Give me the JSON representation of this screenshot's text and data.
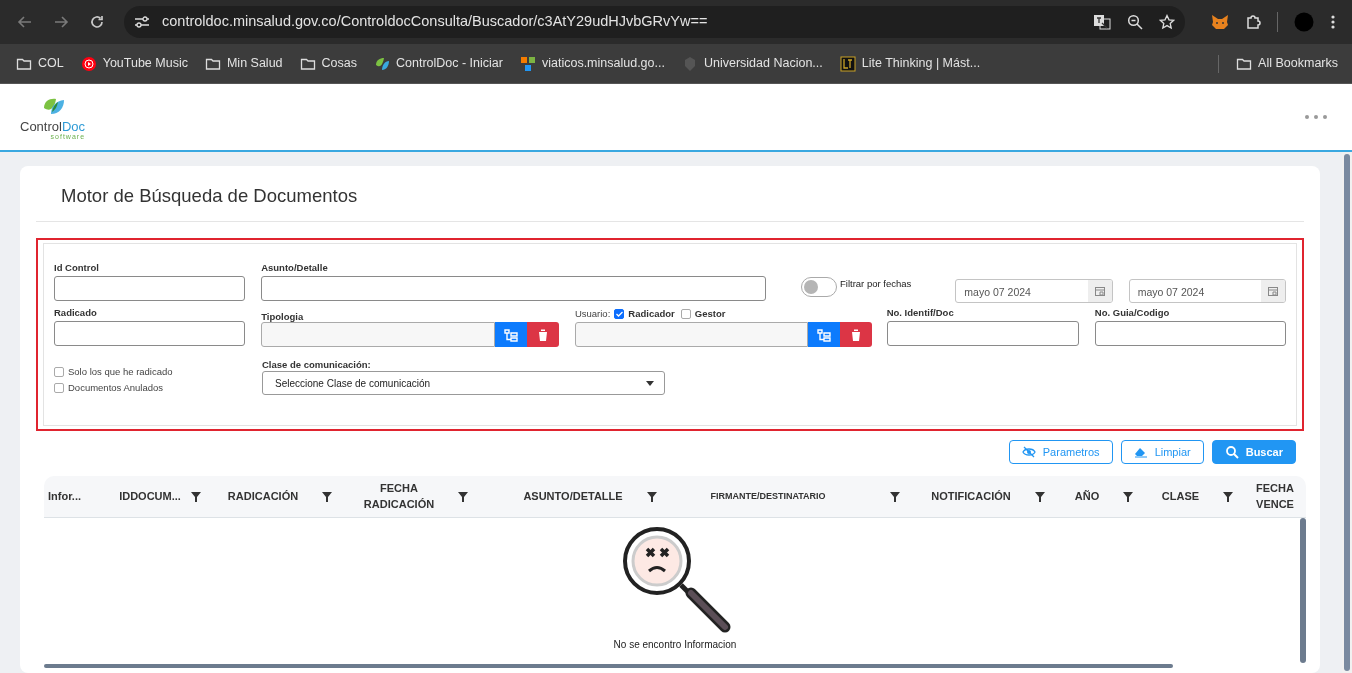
{
  "browser": {
    "url": "controldoc.minsalud.gov.co/ControldocConsulta/Buscador/c3AtY29udHJvbGRvYw==",
    "bookmarks": [
      {
        "label": "COL",
        "kind": "folder"
      },
      {
        "label": "YouTube Music",
        "kind": "site"
      },
      {
        "label": "Min Salud",
        "kind": "folder"
      },
      {
        "label": "Cosas",
        "kind": "folder"
      },
      {
        "label": "ControlDoc - Iniciar",
        "kind": "site"
      },
      {
        "label": "viaticos.minsalud.go...",
        "kind": "site"
      },
      {
        "label": "Universidad Nacion...",
        "kind": "site"
      },
      {
        "label": "Lite Thinking | Mást...",
        "kind": "site"
      }
    ],
    "all_bookmarks": "All Bookmarks"
  },
  "app": {
    "logo_text": "ControlDoc",
    "logo_sub": "software"
  },
  "page_title": "Motor de Búsqueda de Documentos",
  "filters": {
    "id_control": {
      "label": "Id Control"
    },
    "asunto": {
      "label": "Asunto/Detalle"
    },
    "date_filter": {
      "label": "Filtrar por fechas",
      "on": false
    },
    "date_from": {
      "value": "mayo 07 2024"
    },
    "date_to": {
      "value": "mayo 07 2024"
    },
    "radicado": {
      "label": "Radicado"
    },
    "tipologia": {
      "label": "Tipologia"
    },
    "usuario": {
      "label": "Usuario:",
      "options": [
        {
          "label": "Radicador",
          "checked": true
        },
        {
          "label": "Gestor",
          "checked": false
        }
      ]
    },
    "no_identif": {
      "label": "No. Identif/Doc"
    },
    "no_guia": {
      "label": "No. Guia/Codigo"
    },
    "checkboxes": [
      {
        "label": "Solo los que he radicado",
        "checked": false
      },
      {
        "label": "Documentos Anulados",
        "checked": false
      }
    ],
    "clase": {
      "label": "Clase de comunicación:",
      "value": "Seleccione Clase de comunicación"
    }
  },
  "buttons": [
    {
      "label": "Parametros",
      "kind": "outline"
    },
    {
      "label": "Limpiar",
      "kind": "outline"
    },
    {
      "label": "Buscar",
      "kind": "solid"
    }
  ],
  "table": {
    "columns": [
      {
        "label": "Infor...",
        "filterable": false
      },
      {
        "label": "IDDOCUM...",
        "filterable": true
      },
      {
        "label": "RADICACIÓN",
        "filterable": true
      },
      {
        "label": "FECHA RADICACIÓN",
        "filterable": true
      },
      {
        "label": "ASUNTO/DETALLE",
        "filterable": true
      },
      {
        "label": "FIRMANTE/DESTINATARIO",
        "filterable": true
      },
      {
        "label": "NOTIFICACIÓN",
        "filterable": true
      },
      {
        "label": "AÑO",
        "filterable": true
      },
      {
        "label": "CLASE",
        "filterable": true
      },
      {
        "label": "FECHA VENCE",
        "filterable": false
      }
    ],
    "empty_message": "No se encontro Informacion"
  }
}
